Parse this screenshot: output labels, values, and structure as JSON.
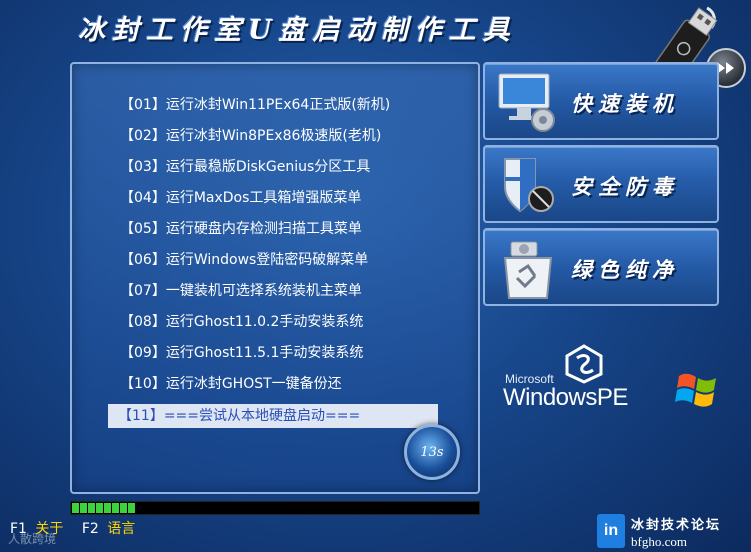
{
  "header": {
    "title": "冰封工作室U盘启动制作工具"
  },
  "menu": {
    "items": [
      "【01】运行冰封Win11PEx64正式版(新机)",
      "【02】运行冰封Win8PEx86极速版(老机)",
      "【03】运行最稳版DiskGenius分区工具",
      "【04】运行MaxDos工具箱增强版菜单",
      "【05】运行硬盘内存检测扫描工具菜单",
      "【06】运行Windows登陆密码破解菜单",
      "【07】一键装机可选择系统装机主菜单",
      "【08】运行Ghost11.0.2手动安装系统",
      "【09】运行Ghost11.5.1手动安装系统",
      "【10】运行冰封GHOST一键备份还"
    ],
    "selected": "【11】===尝试从本地硬盘启动==="
  },
  "timer": {
    "text": "13s"
  },
  "side_buttons": {
    "quick_install": "快速装机",
    "antivirus": "安全防毒",
    "clean": "绿色纯净"
  },
  "winpe": {
    "microsoft": "Microsoft",
    "windowspe": "WindowsPE"
  },
  "progress": {
    "filled_segments": 8,
    "total_segments": 51
  },
  "fkeys": {
    "f1_key": "F1",
    "f1_action": "关于",
    "f2_key": "F2",
    "f2_action": "语言"
  },
  "watermark": "人散跨境",
  "brand": {
    "logo": "in",
    "name": "冰封技术论坛",
    "site": "bfgho.com"
  },
  "colors": {
    "accent": "#ffd800",
    "progress": "#3ed23e",
    "selected_bg": "#dfe6f3",
    "selected_text": "#2a4fb8"
  },
  "icons": [
    "usb-drive-icon",
    "next-arrow-icon",
    "computer-gear-icon",
    "shield-icon",
    "recycle-bin-icon",
    "winpe-logo-icon",
    "windows-flag-icon"
  ]
}
